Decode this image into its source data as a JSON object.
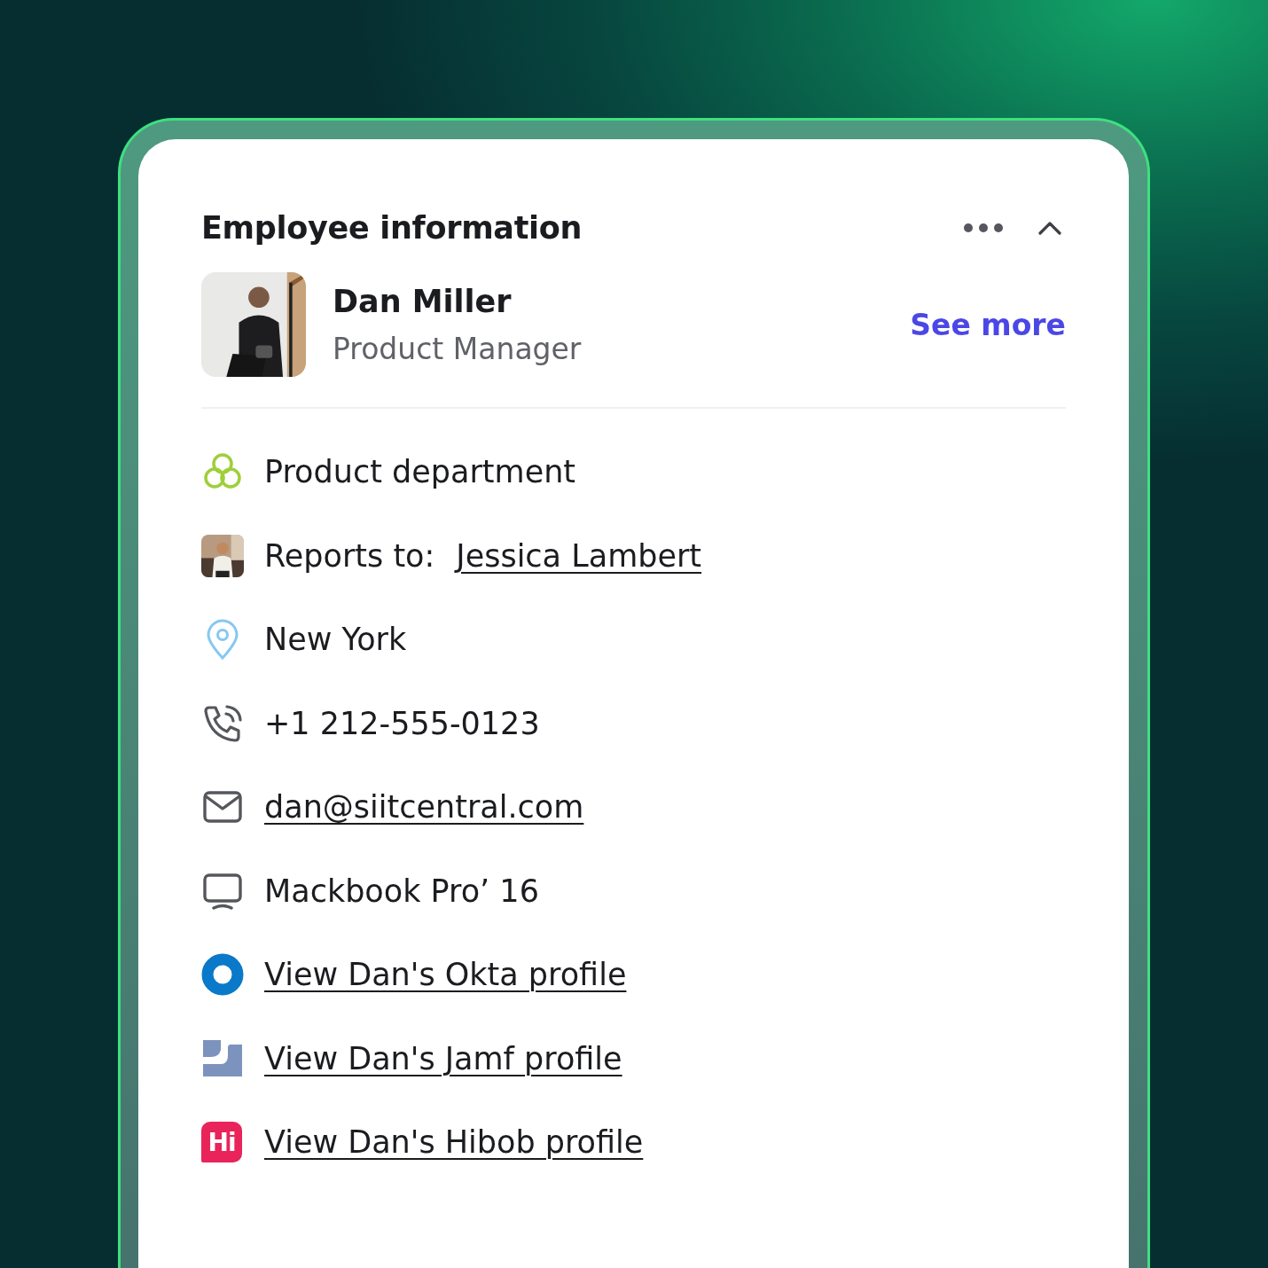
{
  "card": {
    "title": "Employee information",
    "expanded": true
  },
  "profile": {
    "name": "Dan Miller",
    "role": "Product Manager",
    "action": "See more"
  },
  "details": [
    {
      "kind": "department",
      "value": "Product department",
      "link": false
    },
    {
      "kind": "manager",
      "label": "Reports to:",
      "value": "Jessica Lambert",
      "link": true
    },
    {
      "kind": "location",
      "value": "New York",
      "link": false
    },
    {
      "kind": "phone",
      "value": "+1 212-555-0123",
      "link": false
    },
    {
      "kind": "email",
      "value": "dan@siitcentral.com",
      "link": true
    },
    {
      "kind": "device",
      "value": "Mackbook Pro’ 16",
      "link": false
    },
    {
      "kind": "okta",
      "value": "View Dan's Okta profile",
      "link": true
    },
    {
      "kind": "jamf",
      "value": "View Dan's Jamf profile",
      "link": true
    },
    {
      "kind": "hibob",
      "logo": "Hi",
      "value": "View Dan's Hibob profile",
      "link": true
    }
  ]
}
